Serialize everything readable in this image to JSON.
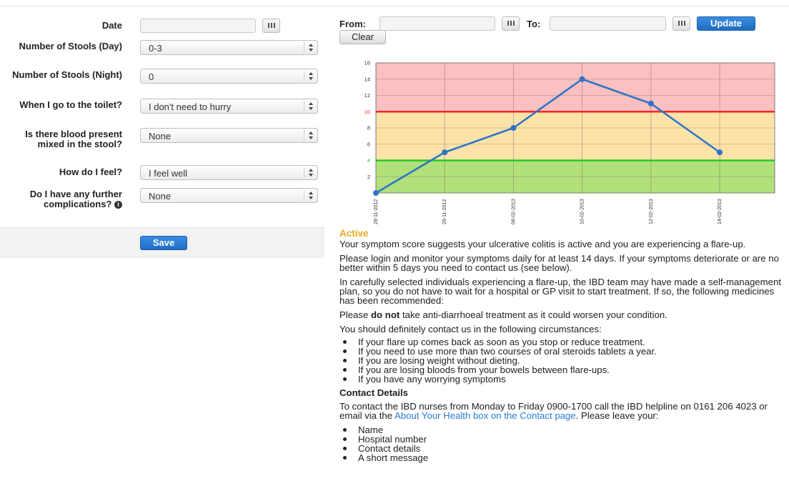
{
  "form": {
    "date_label": "Date",
    "date_value": "",
    "stools_day_label": "Number of Stools (Day)",
    "stools_day_value": "0-3",
    "stools_night_label": "Number of Stools (Night)",
    "stools_night_value": "0",
    "toilet_label": "When I go to the toilet?",
    "toilet_value": "I don't need to hurry",
    "blood_label": "Is there blood present mixed in the stool?",
    "blood_value": "None",
    "feel_label": "How do I feel?",
    "feel_value": "I feel well",
    "complications_label": "Do I have any further complications?",
    "complications_value": "None",
    "save_label": "Save"
  },
  "filter": {
    "from_label": "From:",
    "from_value": "",
    "to_label": "To:",
    "to_value": "",
    "update_label": "Update",
    "clear_label": "Clear"
  },
  "chart_data": {
    "type": "line",
    "categories": [
      "28-11-2012",
      "29-11-2012",
      "08-02-2013",
      "10-02-2013",
      "12-02-2013",
      "14-02-2013"
    ],
    "series": [
      {
        "values": [
          0,
          5,
          8,
          14,
          11,
          5
        ]
      }
    ],
    "ylim": [
      0,
      16
    ],
    "yticks": [
      2,
      4,
      6,
      8,
      10,
      12,
      14,
      16
    ],
    "thresholds": [
      {
        "value": 4,
        "color": "#22cc22"
      },
      {
        "value": 10,
        "color": "#ff2222"
      }
    ],
    "bands": [
      {
        "from": 0,
        "to": 4,
        "color": "#b2e07a"
      },
      {
        "from": 4,
        "to": 10,
        "color": "#fde3a8"
      },
      {
        "from": 10,
        "to": 16,
        "color": "#fcc0c0"
      }
    ],
    "line_color": "#2f74c8",
    "grid": true
  },
  "result": {
    "status": "Active",
    "p1": "Your symptom score suggests your ulcerative colitis is active and you are experiencing a flare-up.",
    "p2": "Please login and monitor your symptoms daily for at least 14 days. If your symptoms deteriorate or are no better within 5 days you need to contact us (see below).",
    "p3": "In carefully selected individuals experiencing a flare-up, the IBD team may have made a self-management plan, so you do not have to wait for a hospital or GP visit to start treatment. If so, the following medicines has been recommended:",
    "p4_pre": "Please ",
    "p4_bold": "do not",
    "p4_post": " take anti-diarrhoeal treatment as it could worsen your condition.",
    "p5": "You should definitely contact us in the following circumstances:",
    "circumstances": [
      "If your flare up comes back as soon as you stop or reduce treatment.",
      "If you need to use more than two courses of oral steroids tablets a year.",
      "If you are losing weight without dieting.",
      "If you are losing bloods from your bowels between flare-ups.",
      "If you have any worrying symptoms"
    ],
    "contact_heading": "Contact Details",
    "contact_pre": "To contact the IBD nurses from Monday to Friday 0900-1700 call the IBD helpline on 0161 206 4023 or email via the ",
    "contact_link": "About Your Health box on the Contact page",
    "contact_post": ". Please leave your:",
    "leave_items": [
      "Name",
      "Hospital number",
      "Contact details",
      "A short message"
    ]
  },
  "icons": {
    "calendar": "calendar-icon",
    "select_arrows": "updown-arrows-icon",
    "info": "info-icon"
  }
}
